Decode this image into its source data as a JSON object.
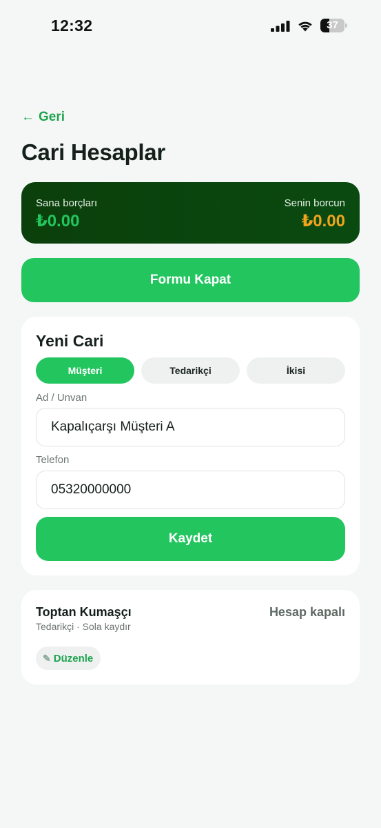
{
  "status_bar": {
    "time": "12:32",
    "battery_level": "37",
    "battery_fraction": 0.37
  },
  "nav": {
    "back_label": "Geri",
    "back_arrow": "←"
  },
  "page": {
    "title": "Cari Hesaplar"
  },
  "balance": {
    "left_label": "Sana borçları",
    "left_value": "₺0.00",
    "right_label": "Senin borcun",
    "right_value": "₺0.00"
  },
  "form_toggle": {
    "label": "Formu Kapat"
  },
  "form": {
    "title": "Yeni Cari",
    "types": [
      {
        "label": "Müşteri",
        "selected": true
      },
      {
        "label": "Tedarikçi",
        "selected": false
      },
      {
        "label": "İkisi",
        "selected": false
      }
    ],
    "name_label": "Ad / Unvan",
    "name_value": "Kapalıçarşı Müşteri A",
    "phone_label": "Telefon",
    "phone_value": "05320000000",
    "save_label": "Kaydet"
  },
  "accounts": [
    {
      "name": "Toptan Kumaşçı",
      "meta": "Tedarikçi · Sola kaydır",
      "status": "Hesap kapalı",
      "edit_label": "Düzenle",
      "edit_icon": "pencil-icon"
    }
  ],
  "colors": {
    "accent": "#22c55e",
    "balance_card": "#0b4510",
    "warning": "#f1a51c",
    "background": "#f5f7f6"
  }
}
